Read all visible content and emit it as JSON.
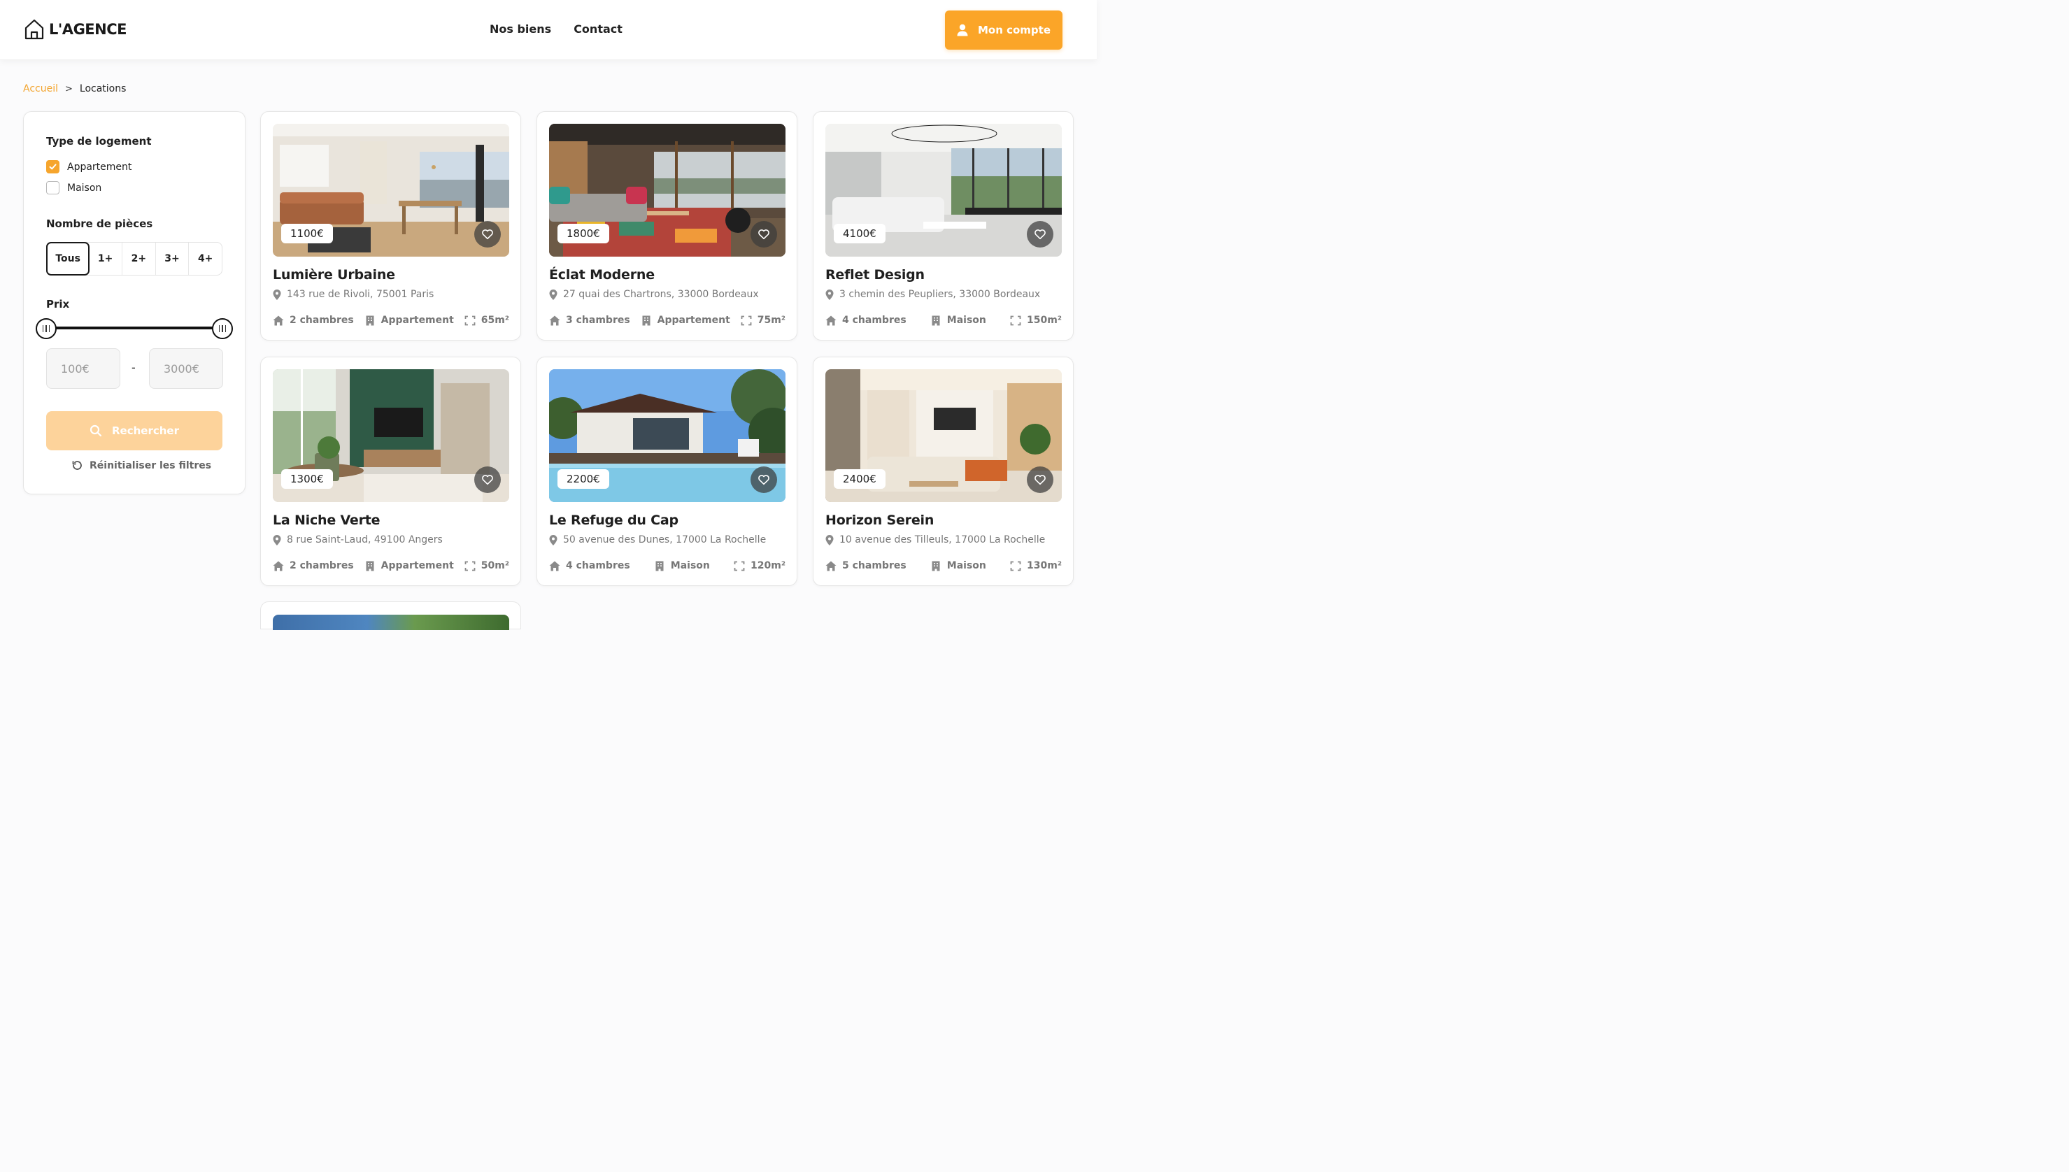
{
  "brand": {
    "name": "L'AGENCE"
  },
  "nav": {
    "items": [
      "Nos biens",
      "Contact"
    ]
  },
  "account": {
    "label": "Mon compte"
  },
  "breadcrumb": {
    "home": "Accueil",
    "separator": ">",
    "current": "Locations"
  },
  "filters": {
    "type_title": "Type de logement",
    "types": [
      {
        "label": "Appartement",
        "checked": true
      },
      {
        "label": "Maison",
        "checked": false
      }
    ],
    "rooms_title": "Nombre de pièces",
    "rooms": [
      "Tous",
      "1+",
      "2+",
      "3+",
      "4+"
    ],
    "rooms_selected": "Tous",
    "price_title": "Prix",
    "price_min_placeholder": "100€",
    "price_max_placeholder": "3000€",
    "price_range": [
      100,
      3000
    ],
    "dash": "-",
    "search_label": "Rechercher",
    "reset_label": "Réinitialiser les filtres"
  },
  "colors": {
    "accent": "#fba528",
    "accent_light": "#fdd39b",
    "text": "#1f1f1f",
    "muted": "#777777"
  },
  "listings": [
    {
      "price": "1100€",
      "title": "Lumière Urbaine",
      "address": "143 rue de Rivoli, 75001 Paris",
      "bedrooms": "2 chambres",
      "type": "Appartement",
      "area": "65m²"
    },
    {
      "price": "1800€",
      "title": "Éclat Moderne",
      "address": "27 quai des Chartrons, 33000 Bordeaux",
      "bedrooms": "3 chambres",
      "type": "Appartement",
      "area": "75m²"
    },
    {
      "price": "4100€",
      "title": "Reflet Design",
      "address": "3 chemin des Peupliers, 33000 Bordeaux",
      "bedrooms": "4 chambres",
      "type": "Maison",
      "area": "150m²"
    },
    {
      "price": "1300€",
      "title": "La Niche Verte",
      "address": "8 rue Saint-Laud, 49100 Angers",
      "bedrooms": "2 chambres",
      "type": "Appartement",
      "area": "50m²"
    },
    {
      "price": "2200€",
      "title": "Le Refuge du Cap",
      "address": "50 avenue des Dunes, 17000 La Rochelle",
      "bedrooms": "4 chambres",
      "type": "Maison",
      "area": "120m²"
    },
    {
      "price": "2400€",
      "title": "Horizon Serein",
      "address": "10 avenue des Tilleuls, 17000 La Rochelle",
      "bedrooms": "5 chambres",
      "type": "Maison",
      "area": "130m²"
    }
  ]
}
